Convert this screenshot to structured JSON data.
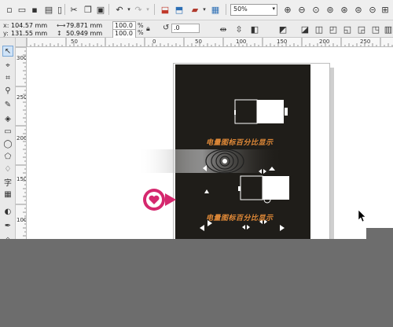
{
  "toolbar": {
    "zoom_level": "50%",
    "zoom_arrow": "▾"
  },
  "propbar": {
    "x_label": "x:",
    "x_value": "104.57 mm",
    "y_label": "y:",
    "y_value": "131.55 mm",
    "width_value": "79.871 mm",
    "height_value": "50.949 mm",
    "scale_x": "100.0",
    "scale_y": "100.0",
    "scale_unit": "%",
    "rotation": ".0"
  },
  "rulers": {
    "h_labels": [
      "50",
      "0",
      "50",
      "100",
      "150",
      "200",
      "250"
    ],
    "v_labels": [
      "300",
      "250",
      "200",
      "150",
      "100",
      "50"
    ]
  },
  "design": {
    "caption": "电量图标百分比显示",
    "page_color": "#1f1d19",
    "caption_color": "#e28a38"
  },
  "icons": {
    "heart_badge": "heart-icon",
    "cursor": "mouse-pointer-icon"
  }
}
